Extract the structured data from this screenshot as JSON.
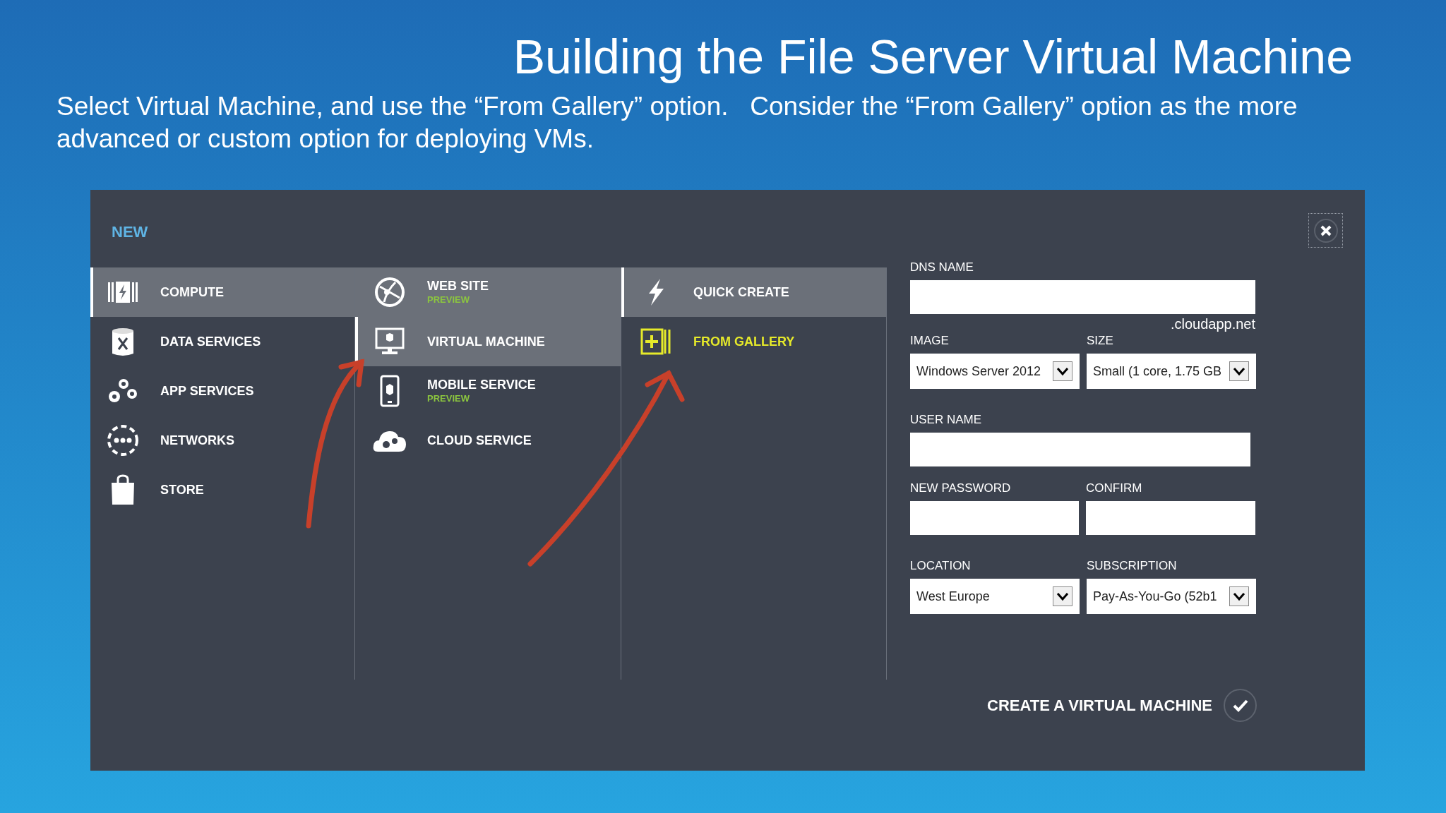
{
  "slide": {
    "title": "Building the File Server Virtual Machine",
    "subtitle": "Select Virtual Machine, and use the “From Gallery” option.   Consider the “From Gallery” option as the more advanced or custom option for deploying VMs."
  },
  "dialog": {
    "heading": "NEW",
    "categories": [
      {
        "label": "COMPUTE",
        "selected": true,
        "shaded": true
      },
      {
        "label": "DATA SERVICES",
        "selected": false,
        "shaded": false
      },
      {
        "label": "APP SERVICES",
        "selected": false,
        "shaded": false
      },
      {
        "label": "NETWORKS",
        "selected": false,
        "shaded": false
      },
      {
        "label": "STORE",
        "selected": false,
        "shaded": false
      }
    ],
    "services": [
      {
        "label": "WEB SITE",
        "badge": "PREVIEW",
        "selected": false,
        "shaded": true
      },
      {
        "label": "VIRTUAL MACHINE",
        "selected": true,
        "shaded": true
      },
      {
        "label": "MOBILE SERVICE",
        "badge": "PREVIEW",
        "selected": false,
        "shaded": false
      },
      {
        "label": "CLOUD SERVICE",
        "selected": false,
        "shaded": false
      }
    ],
    "options": [
      {
        "label": "QUICK CREATE",
        "selected": true,
        "shaded": true,
        "accent": false
      },
      {
        "label": "FROM GALLERY",
        "selected": false,
        "shaded": false,
        "accent": true
      }
    ],
    "form": {
      "dns_name": {
        "label": "DNS NAME",
        "suffix": ".cloudapp.net"
      },
      "image": {
        "label": "IMAGE",
        "value": "Windows Server 2012"
      },
      "size": {
        "label": "SIZE",
        "value": "Small (1 core, 1.75 GB"
      },
      "user_name": {
        "label": "USER NAME"
      },
      "new_password": {
        "label": "NEW PASSWORD"
      },
      "confirm": {
        "label": "CONFIRM"
      },
      "location": {
        "label": "LOCATION",
        "value": "West Europe"
      },
      "subscription": {
        "label": "SUBSCRIPTION",
        "value": "Pay-As-You-Go (52b1"
      }
    },
    "create_label": "CREATE A VIRTUAL MACHINE"
  }
}
